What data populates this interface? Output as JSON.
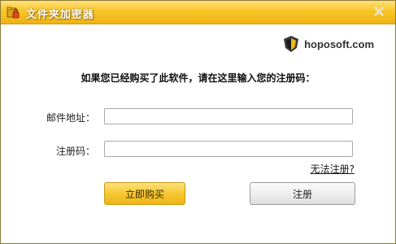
{
  "window": {
    "title": "文件夹加密器"
  },
  "brand": {
    "name": "hoposoft.com"
  },
  "form": {
    "prompt": "如果您已经购买了此软件，请在这里输入您的注册码：",
    "email_label": "邮件地址：",
    "email_value": "",
    "code_label": "注册码：",
    "code_value": "",
    "cannot_register_link": "无法注册?"
  },
  "buttons": {
    "buy_label": "立即购买",
    "register_label": "注册"
  },
  "colors": {
    "titlebar_accent": "#f8c628",
    "buy_button": "#f6c833"
  },
  "icons": {
    "app": "folder-lock-icon",
    "close": "close-icon",
    "brand": "hoposoft-shield-logo"
  }
}
